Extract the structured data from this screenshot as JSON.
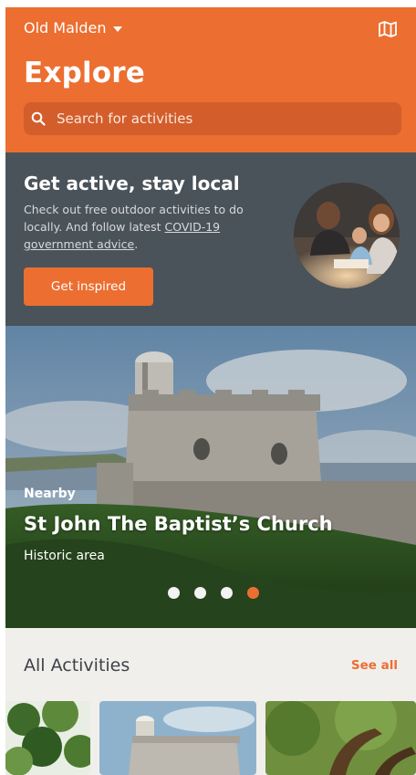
{
  "header": {
    "location": "Old Malden",
    "title": "Explore",
    "search_placeholder": "Search for activities",
    "map_icon": "map-icon",
    "search_icon": "search-icon",
    "caret_icon": "chevron-down-icon"
  },
  "promo": {
    "title": "Get active, stay local",
    "body_text": "Check out free outdoor activities to do locally. And follow latest ",
    "body_link": "COVID-19 government advice",
    "body_end": ".",
    "button_label": "Get inspired"
  },
  "hero": {
    "tag": "Nearby",
    "title": "St John The Baptist’s Church",
    "subtitle": "Historic area",
    "dots_total": 4,
    "active_dot": 4
  },
  "activities": {
    "title": "All Activities",
    "see_all": "See all"
  },
  "colors": {
    "accent": "#ec6e30",
    "promo_bg": "#4a535a",
    "page_bg": "#f1efec"
  }
}
